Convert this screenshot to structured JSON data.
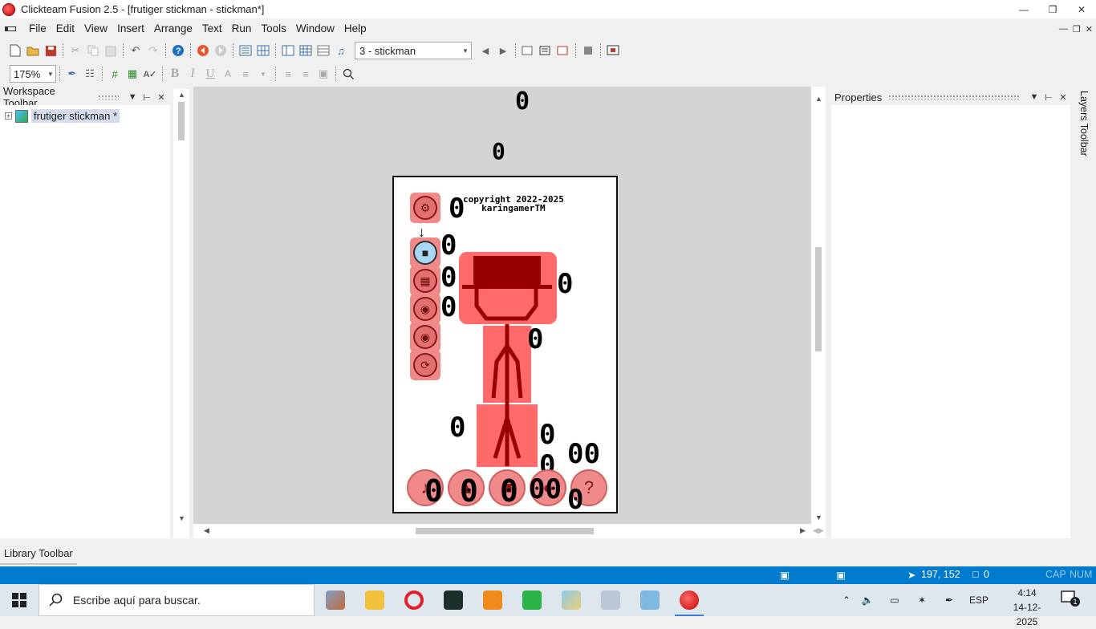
{
  "window": {
    "title": "Clickteam Fusion 2.5 - [frutiger stickman - stickman*]",
    "controls": [
      "minimize-icon",
      "restore-icon",
      "close-icon"
    ]
  },
  "menu": {
    "items": [
      "File",
      "Edit",
      "View",
      "Insert",
      "Arrange",
      "Text",
      "Run",
      "Tools",
      "Window",
      "Help"
    ]
  },
  "toolbar": {
    "frame_select": "3 - stickman",
    "zoom": "175%"
  },
  "workspace": {
    "title": "Workspace Toolbar",
    "tree_expander": "+",
    "tree_item": "frutiger stickman *"
  },
  "properties": {
    "title": "Properties"
  },
  "layers": {
    "title": "Layers Toolbar"
  },
  "library": {
    "title": "Library Toolbar"
  },
  "editor": {
    "counter_glyph": "0",
    "double_counter": "00",
    "copyright_line1": "copyright 2022-2025",
    "copyright_line2": "karingamerTM",
    "arrow": "↓",
    "help_glyph": "?",
    "colors": {
      "background": "#d4d4d4",
      "stickman_red": "#990000",
      "button_pink": "#f08a8a",
      "avatar_blue": "#a8d8f5"
    }
  },
  "statusbar": {
    "coords": "197, 152",
    "objects": "0",
    "caps": "CAP",
    "num": "NUM",
    "color": "#007acc"
  },
  "taskbar": {
    "search_placeholder": "Escribe aquí para buscar.",
    "language": "ESP",
    "time": "4:14",
    "date": "14-12-2025",
    "notification_count": "1"
  }
}
